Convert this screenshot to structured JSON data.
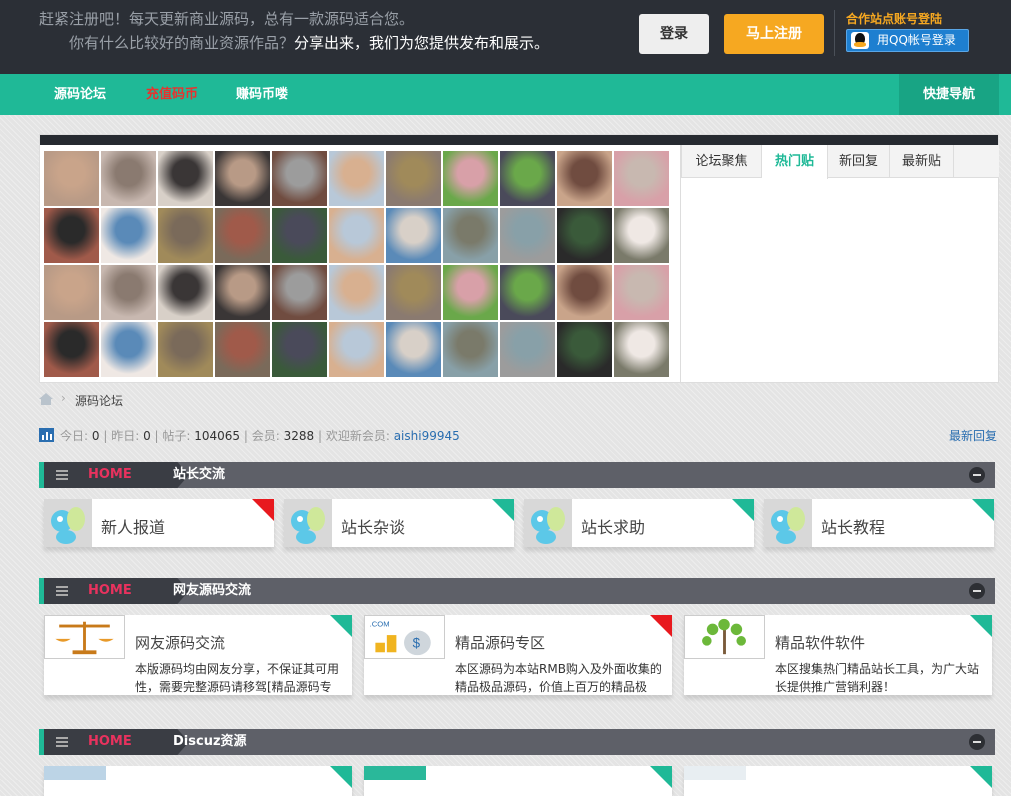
{
  "topbar": {
    "welcome_line1": "赶紧注册吧！每天更新商业源码，总有一款源码适合您。",
    "welcome_line2_a": "你有什么比较好的商业资源作品？",
    "welcome_line2_b": "分享出来，",
    "welcome_line2_c": "我们为您提供发布和展示。",
    "login_label": "登录",
    "register_label": "马上注册",
    "partner_label": "合作站点账号登陆",
    "qq_login_label": "用QQ帐号登录"
  },
  "nav": {
    "items": [
      "源码论坛",
      "充值码币",
      "赚码币喽"
    ],
    "quick_nav": "快捷导航"
  },
  "panel": {
    "tabs": [
      "论坛聚焦",
      "热门贴",
      "新回复",
      "最新贴"
    ],
    "active_tab": "热门贴"
  },
  "breadcrumb": {
    "current": "源码论坛"
  },
  "stats": {
    "today_label": "今日:",
    "today": "0",
    "yesterday_label": "昨日:",
    "yesterday": "0",
    "posts_label": "帖子:",
    "posts": "104065",
    "members_label": "会员:",
    "members": "3288",
    "newest_label": "欢迎新会员:",
    "newest_user": "aishi99945",
    "latest_reply": "最新回复"
  },
  "sections": [
    {
      "home": "HOME",
      "title": "站长交流"
    },
    {
      "home": "HOME",
      "title": "网友源码交流"
    },
    {
      "home": "HOME",
      "title": "Discuz资源"
    }
  ],
  "forums1": [
    {
      "name": "新人报道",
      "corner": "red"
    },
    {
      "name": "站长杂谈",
      "corner": "green"
    },
    {
      "name": "站长求助",
      "corner": "green"
    },
    {
      "name": "站长教程",
      "corner": "green"
    }
  ],
  "forums2": [
    {
      "name": "网友源码交流",
      "desc": "本版源码均由网友分享，不保证其可用性，需要完整源码请移驾[精品源码专",
      "corner": "green",
      "icon": "scale-icon"
    },
    {
      "name": "精品源码专区",
      "desc": "本区源码为本站RMB购入及外面收集的精品极品源码，价值上百万的精品极",
      "corner": "red",
      "icon": "money-bag-icon",
      "icon_text": ".COM"
    },
    {
      "name": "精品软件软件",
      "desc": "本区搜集热门精品站长工具，为广大站长提供推广营销利器！",
      "corner": "green",
      "icon": "tree-icon"
    }
  ],
  "colors": {
    "accent": "#1fb997",
    "dark": "#2b2f36",
    "orange": "#f6a821",
    "red": "#e8191e"
  }
}
